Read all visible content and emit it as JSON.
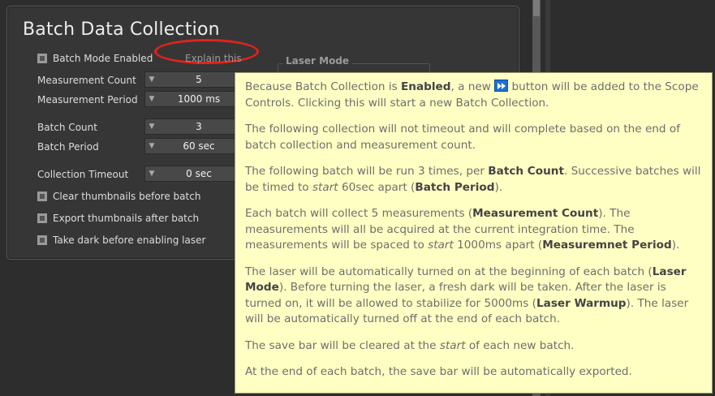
{
  "panel": {
    "title": "Batch Data Collection",
    "batch_mode_label": "Batch Mode Enabled",
    "explain_link": "Explain this",
    "fields": [
      {
        "label": "Measurement Count",
        "value": "5"
      },
      {
        "label": "Measurement Period",
        "value": "1000 ms"
      },
      {
        "label": "Batch Count",
        "value": "3"
      },
      {
        "label": "Batch Period",
        "value": "60 sec"
      },
      {
        "label": "Collection Timeout",
        "value": "0 sec"
      }
    ],
    "checkboxes": [
      "Clear thumbnails before batch",
      "Export thumbnails after batch",
      "Take dark before enabling laser"
    ],
    "laser_group_title": "Laser Mode"
  },
  "icons": {
    "spin_down": "▼",
    "fast_forward": "fast-forward-icon"
  },
  "colors": {
    "tooltip_bg": "#ffffc4",
    "highlight_oval": "#e0241b",
    "ff_button": "#1f6fd0"
  },
  "tooltip": {
    "p1_a": "Because Batch Collection is ",
    "p1_b": "Enabled",
    "p1_c": ", a new ",
    "p1_d": " button will be added to the Scope Controls. Clicking this will start a new Batch Collection.",
    "p2": "The following collection will not timeout and will complete based on the end of batch collection and measurement count.",
    "p3_a": "The following batch will be run 3 times, per ",
    "p3_b": "Batch Count",
    "p3_c": ". Successive batches will be timed to ",
    "p3_d": "start",
    "p3_e": " 60sec apart (",
    "p3_f": "Batch Period",
    "p3_g": ").",
    "p4_a": "Each batch will collect 5 measurements (",
    "p4_b": "Measurement Count",
    "p4_c": "). The measurements will all be acquired at the current integration time. The measurements will be spaced to ",
    "p4_d": "start",
    "p4_e": " 1000ms apart (",
    "p4_f": "Measuremnet Period",
    "p4_g": ").",
    "p5_a": "The laser will be automatically turned on at the beginning of each batch (",
    "p5_b": "Laser Mode",
    "p5_c": "). Before turning the laser, a fresh dark will be taken. After the laser is turned on, it will be allowed to stabilize for 5000ms (",
    "p5_d": "Laser Warmup",
    "p5_e": "). The laser will be automatically turned off at the end of each batch.",
    "p6_a": "The save bar will be cleared at the ",
    "p6_b": "start",
    "p6_c": " of each new batch.",
    "p7": "At the end of each batch, the save bar will be automatically exported."
  }
}
